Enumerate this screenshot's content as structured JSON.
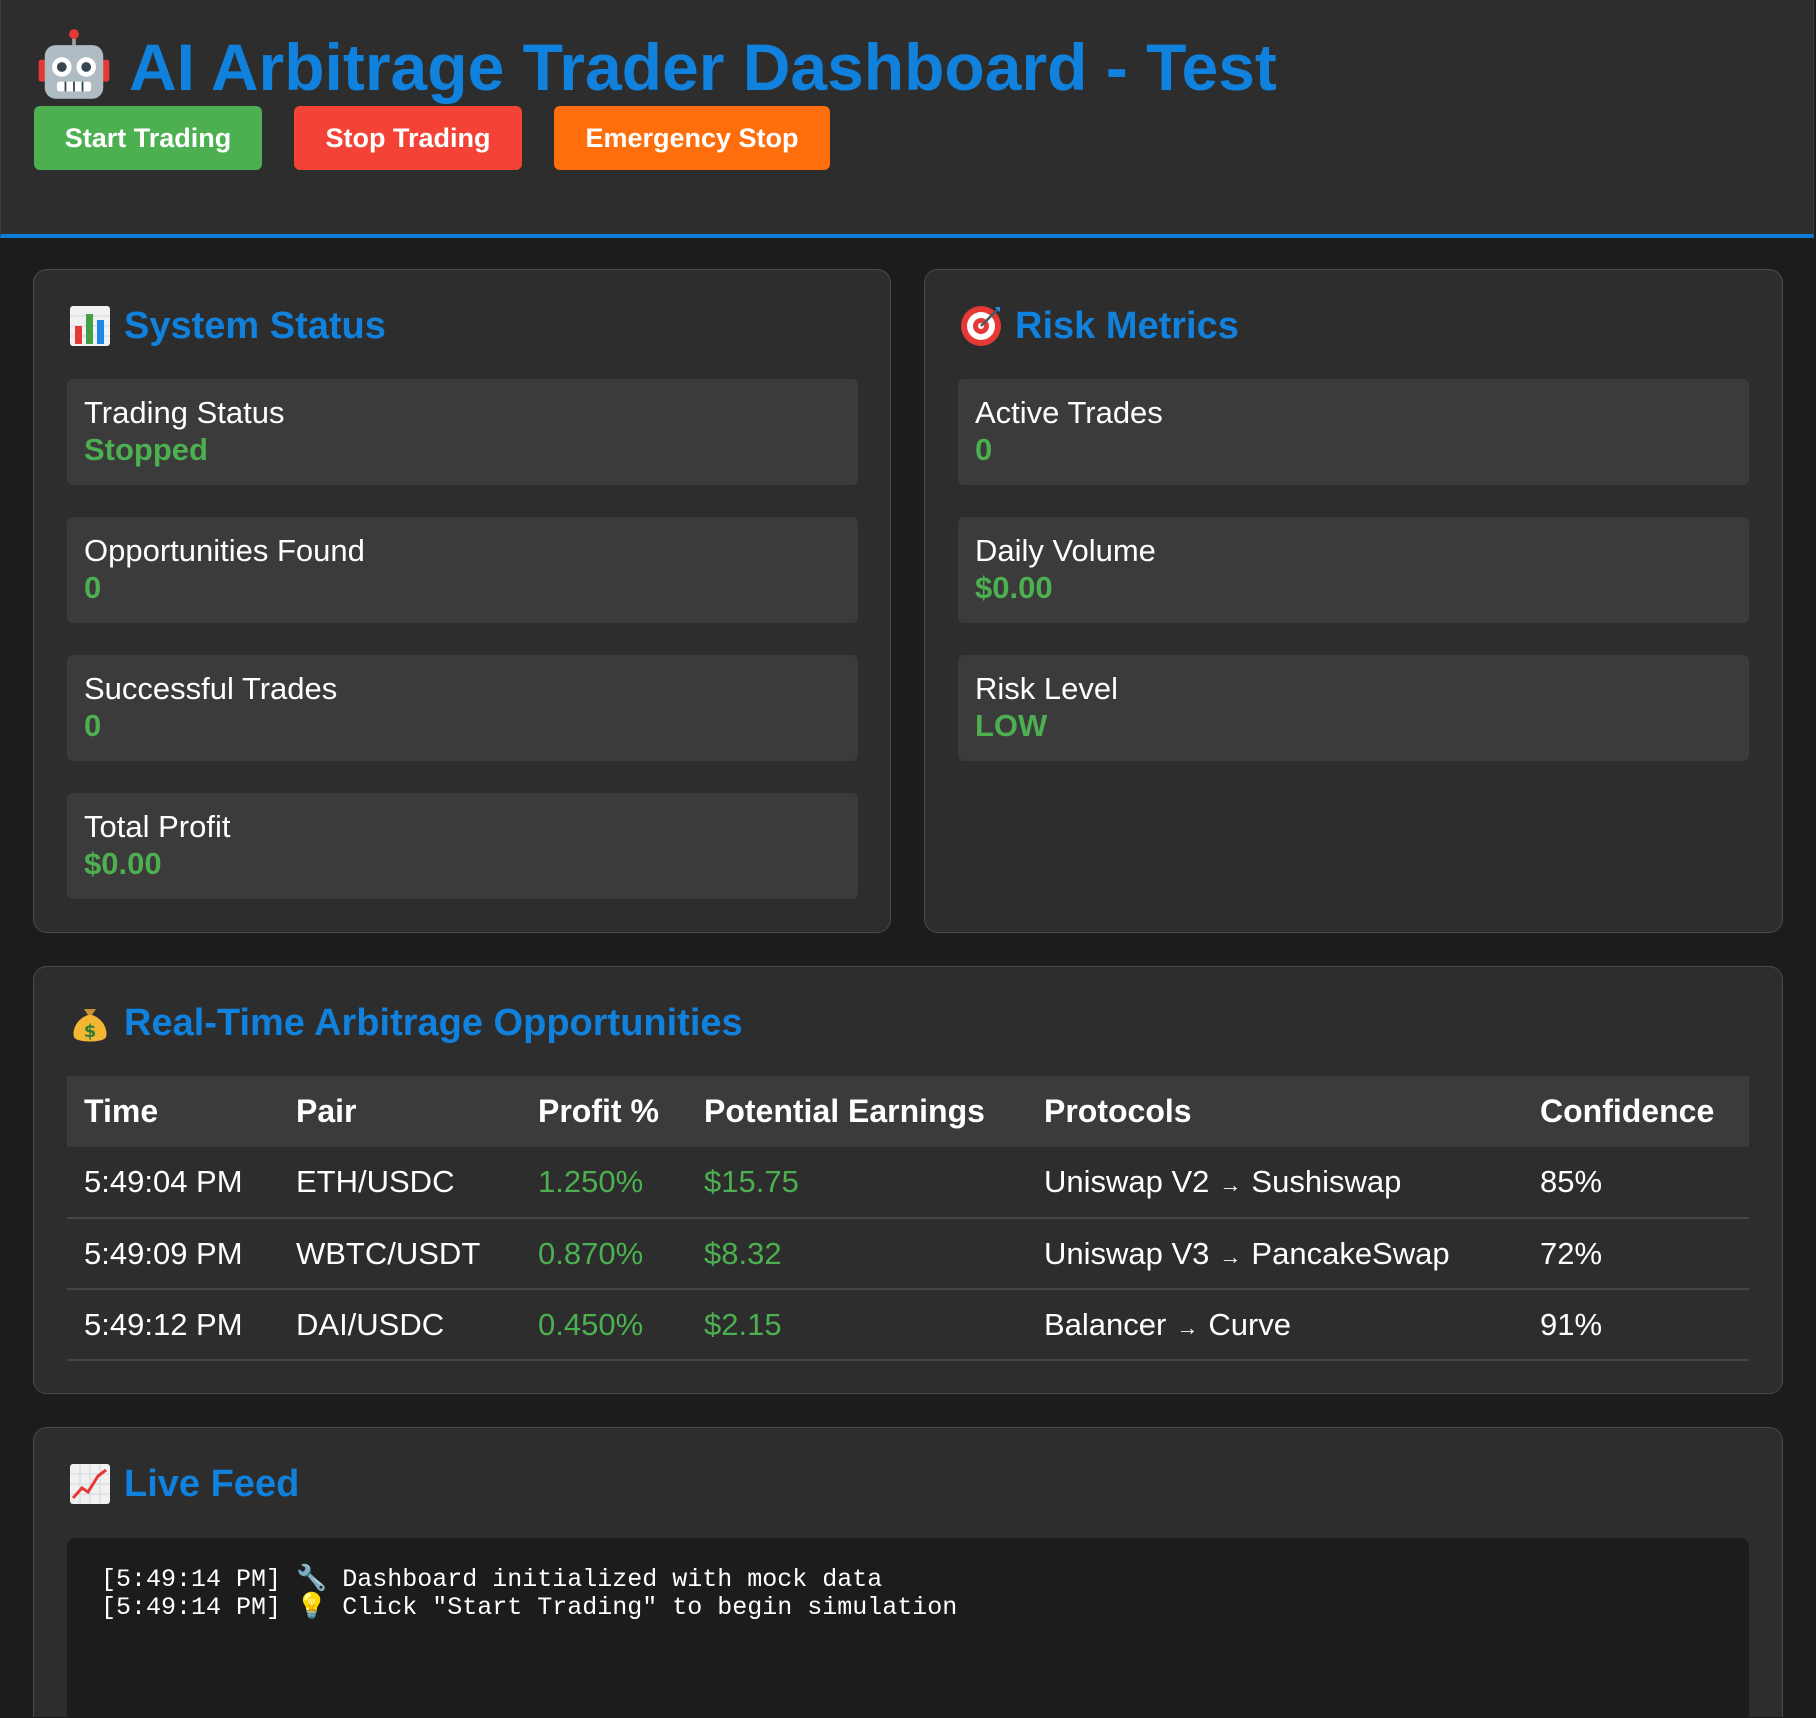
{
  "header": {
    "icon": "robot-icon",
    "title": "AI Arbitrage Trader Dashboard - Test",
    "buttons": {
      "start": "Start Trading",
      "stop": "Stop Trading",
      "emergency": "Emergency Stop"
    },
    "colors": {
      "accent": "#1081dc",
      "start": "#4cb050",
      "stop": "#f44336",
      "emergency": "#ff6e0d",
      "positive": "#4caf50"
    }
  },
  "system_status": {
    "icon": "bar-chart-icon",
    "title": "System Status",
    "metrics": [
      {
        "label": "Trading Status",
        "value": "Stopped"
      },
      {
        "label": "Opportunities Found",
        "value": "0"
      },
      {
        "label": "Successful Trades",
        "value": "0"
      },
      {
        "label": "Total Profit",
        "value": "$0.00"
      }
    ]
  },
  "risk_metrics": {
    "icon": "target-icon",
    "title": "Risk Metrics",
    "metrics": [
      {
        "label": "Active Trades",
        "value": "0"
      },
      {
        "label": "Daily Volume",
        "value": "$0.00"
      },
      {
        "label": "Risk Level",
        "value": "LOW"
      }
    ]
  },
  "opportunities": {
    "icon": "money-bag-icon",
    "title": "Real-Time Arbitrage Opportunities",
    "columns": [
      "Time",
      "Pair",
      "Profit %",
      "Potential Earnings",
      "Protocols",
      "Confidence"
    ],
    "arrow": "→",
    "rows": [
      {
        "time": "5:49:04 PM",
        "pair": "ETH/USDC",
        "profit": "1.250%",
        "earnings": "$15.75",
        "from": "Uniswap V2",
        "to": "Sushiswap",
        "confidence": "85%"
      },
      {
        "time": "5:49:09 PM",
        "pair": "WBTC/USDT",
        "profit": "0.870%",
        "earnings": "$8.32",
        "from": "Uniswap V3",
        "to": "PancakeSwap",
        "confidence": "72%"
      },
      {
        "time": "5:49:12 PM",
        "pair": "DAI/USDC",
        "profit": "0.450%",
        "earnings": "$2.15",
        "from": "Balancer",
        "to": "Curve",
        "confidence": "91%"
      }
    ]
  },
  "live_feed": {
    "icon": "chart-increasing-icon",
    "title": "Live Feed",
    "lines": [
      {
        "time": "[5:49:14 PM]",
        "icon": "wrench-icon",
        "glyph": "🔧",
        "text": "Dashboard initialized with mock data"
      },
      {
        "time": "[5:49:14 PM]",
        "icon": "light-bulb-icon",
        "glyph": "💡",
        "text": "Click \"Start Trading\" to begin simulation"
      }
    ]
  }
}
